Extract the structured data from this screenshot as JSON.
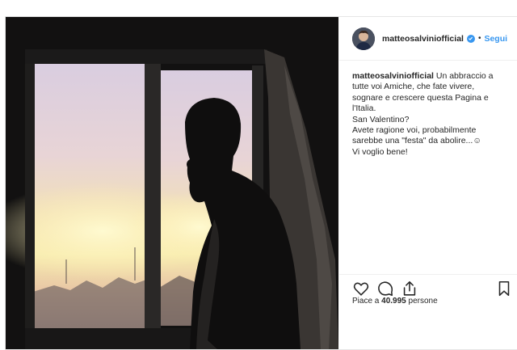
{
  "post": {
    "username": "matteosalviniofficial",
    "follow_label": "Segui",
    "separator": "•",
    "caption_lines": [
      "Un abbraccio a tutte voi Amiche, che fate vivere, sognare e crescere questa Pagina e l'Italia.",
      "San Valentino?",
      "Avete ragione voi, probabilmente sarebbe una \"festa\" da abolire...",
      "Vi voglio bene!"
    ],
    "emoji": "☺",
    "likes_prefix": "Piace a ",
    "likes_count": "40.995",
    "likes_suffix": " persone"
  },
  "icons": {
    "like": "heart-icon",
    "comment": "comment-icon",
    "share": "share-icon",
    "save": "bookmark-icon",
    "verified": "verified-badge-icon"
  },
  "colors": {
    "link": "#3897f0",
    "text": "#262626",
    "border": "#efefef"
  }
}
